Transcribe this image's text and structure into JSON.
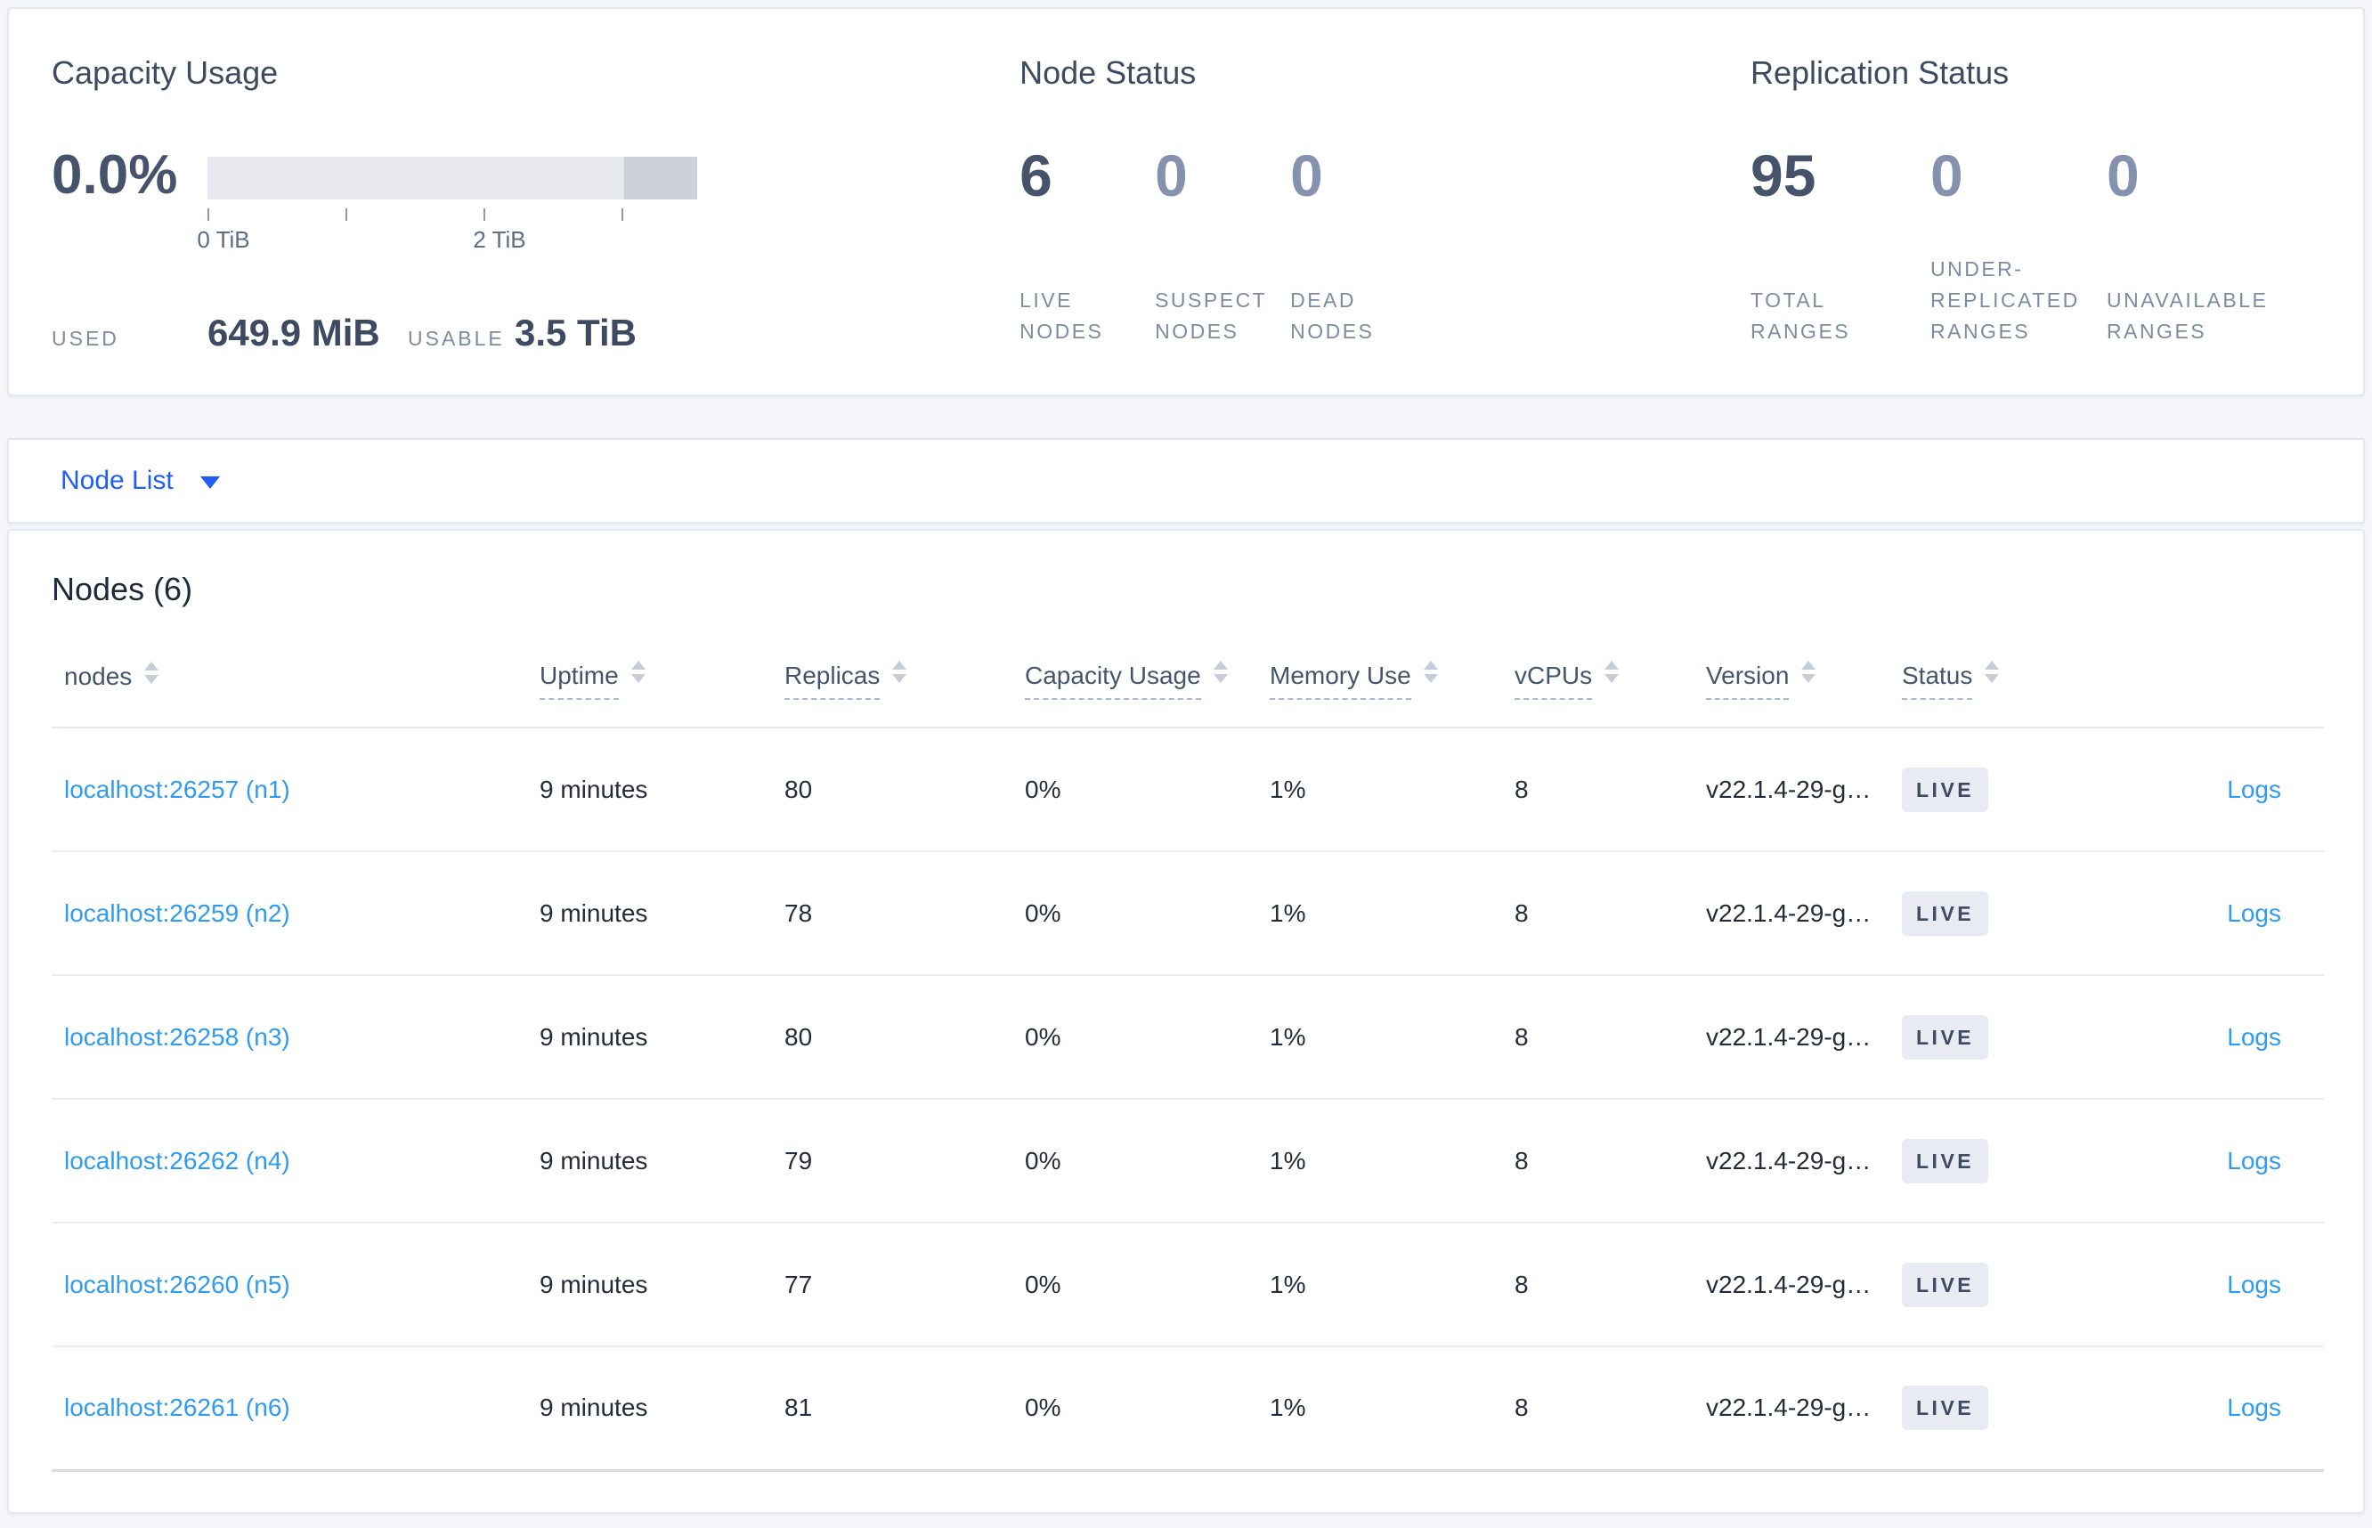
{
  "summary": {
    "capacity": {
      "title": "Capacity Usage",
      "percent": "0.0%",
      "tick_labels": [
        "0 TiB",
        "2 TiB"
      ],
      "used_label": "USED",
      "used_value": "649.9 MiB",
      "usable_label": "USABLE",
      "usable_value": "3.5 TiB"
    },
    "node_status": {
      "title": "Node Status",
      "metrics": [
        {
          "value": "6",
          "label": "LIVE NODES",
          "emphasis": true
        },
        {
          "value": "0",
          "label": "SUSPECT NODES",
          "emphasis": false
        },
        {
          "value": "0",
          "label": "DEAD NODES",
          "emphasis": false
        }
      ]
    },
    "replication": {
      "title": "Replication Status",
      "metrics": [
        {
          "value": "95",
          "label": "TOTAL RANGES",
          "emphasis": true
        },
        {
          "value": "0",
          "label": "UNDER-REPLICATED RANGES",
          "emphasis": false
        },
        {
          "value": "0",
          "label": "UNAVAILABLE RANGES",
          "emphasis": false
        }
      ]
    }
  },
  "view_selector": {
    "label": "Node List"
  },
  "nodes_section": {
    "title": "Nodes (6)",
    "columns": [
      {
        "label": "nodes",
        "dashed": false
      },
      {
        "label": "Uptime",
        "dashed": true
      },
      {
        "label": "Replicas",
        "dashed": true
      },
      {
        "label": "Capacity Usage",
        "dashed": true
      },
      {
        "label": "Memory Use",
        "dashed": true
      },
      {
        "label": "vCPUs",
        "dashed": true
      },
      {
        "label": "Version",
        "dashed": true
      },
      {
        "label": "Status",
        "dashed": true
      }
    ],
    "rows": [
      {
        "node": "localhost:26257 (n1)",
        "uptime": "9 minutes",
        "replicas": "80",
        "capacity": "0%",
        "memory": "1%",
        "vcpus": "8",
        "version": "v22.1.4-29-g…",
        "status": "LIVE",
        "logs": "Logs"
      },
      {
        "node": "localhost:26259 (n2)",
        "uptime": "9 minutes",
        "replicas": "78",
        "capacity": "0%",
        "memory": "1%",
        "vcpus": "8",
        "version": "v22.1.4-29-g…",
        "status": "LIVE",
        "logs": "Logs"
      },
      {
        "node": "localhost:26258 (n3)",
        "uptime": "9 minutes",
        "replicas": "80",
        "capacity": "0%",
        "memory": "1%",
        "vcpus": "8",
        "version": "v22.1.4-29-g…",
        "status": "LIVE",
        "logs": "Logs"
      },
      {
        "node": "localhost:26262 (n4)",
        "uptime": "9 minutes",
        "replicas": "79",
        "capacity": "0%",
        "memory": "1%",
        "vcpus": "8",
        "version": "v22.1.4-29-g…",
        "status": "LIVE",
        "logs": "Logs"
      },
      {
        "node": "localhost:26260 (n5)",
        "uptime": "9 minutes",
        "replicas": "77",
        "capacity": "0%",
        "memory": "1%",
        "vcpus": "8",
        "version": "v22.1.4-29-g…",
        "status": "LIVE",
        "logs": "Logs"
      },
      {
        "node": "localhost:26261 (n6)",
        "uptime": "9 minutes",
        "replicas": "81",
        "capacity": "0%",
        "memory": "1%",
        "vcpus": "8",
        "version": "v22.1.4-29-g…",
        "status": "LIVE",
        "logs": "Logs"
      }
    ]
  },
  "colors": {
    "accent_blue": "#1f5ef5",
    "link_blue": "#2f9bf2",
    "badge_bg": "#e8ebf2",
    "badge_text": "#3e4b60",
    "bar_fill": "#e7e9ee",
    "bar_extra": "#ccd1db",
    "page_bg": "#f4f6fa"
  }
}
